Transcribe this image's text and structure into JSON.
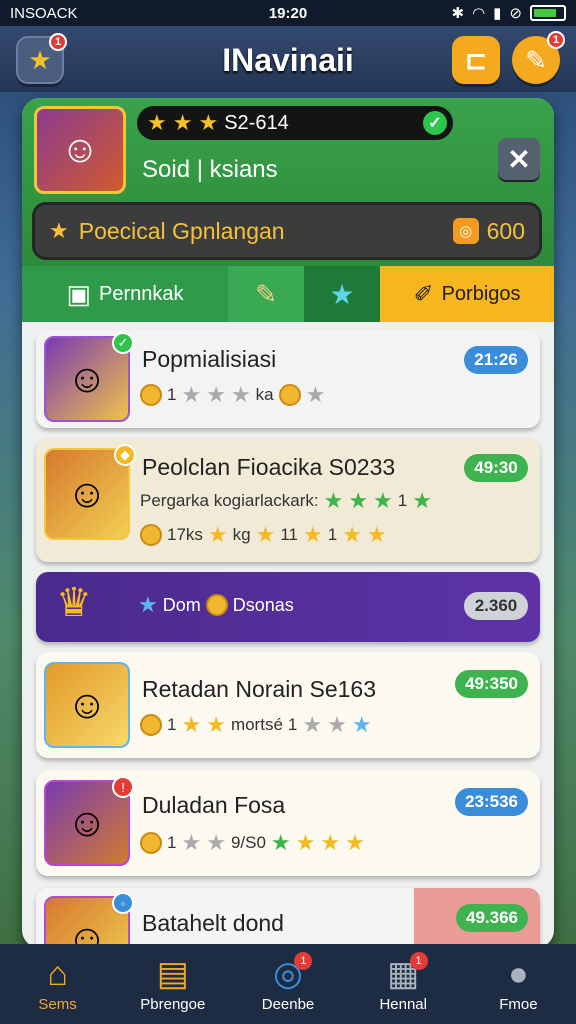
{
  "status": {
    "left": "INSOACK",
    "time": "19:20"
  },
  "header": {
    "title": "INavinaii",
    "left_badge": "1",
    "right_badge": "1"
  },
  "profile": {
    "stars_text": "S2-614",
    "name": "Soid | ksians",
    "special_label": "Poecical Gpnlangan",
    "special_value": "600"
  },
  "tabs": [
    {
      "label": "Pernnkak",
      "color": "#2f9a49"
    },
    {
      "label": "",
      "color": "#3aa954"
    },
    {
      "label": "",
      "color": "#1f7a3a"
    },
    {
      "label": "Porbigos",
      "color": "#f7b51e"
    }
  ],
  "cards": [
    {
      "name": "Popmialisiasi",
      "line1": "1",
      "line1b": "ka",
      "pill": "21:26",
      "pill_color": "#3a8dd8"
    },
    {
      "name": "Peolclan Fioacika S0233",
      "sub": "Pergarka kogiarlackark:",
      "sub_b": "1",
      "line1": "17ks",
      "line1b": "kg",
      "line1c": "11",
      "line1d": "1",
      "pill": "49:30",
      "pill_color": "#3fb34f"
    },
    {
      "name": "Dom",
      "name_b": "Dsonas",
      "pill": "2.360",
      "pill_color": "#cfd3d8"
    },
    {
      "name": "Retadan Norain Se163",
      "line1": "1",
      "line1b": "mortsé",
      "line1c": "1",
      "pill": "49:350",
      "pill_color": "#3fb34f"
    },
    {
      "name": "Duladan Fosa",
      "line1": "1",
      "line1b": "9/S0",
      "pill": "23:536",
      "pill_color": "#3a8dd8"
    },
    {
      "name": "Batahelt dond",
      "pill": "49.366",
      "pill_color": "#3fb34f"
    }
  ],
  "nav": [
    {
      "label": "Sems",
      "icon": "home-icon",
      "badge": ""
    },
    {
      "label": "Pbrengoe",
      "icon": "cards-icon",
      "badge": ""
    },
    {
      "label": "Deenbe",
      "icon": "target-icon",
      "badge": "1"
    },
    {
      "label": "Hennal",
      "icon": "grid-icon",
      "badge": "1"
    },
    {
      "label": "Fmoe",
      "icon": "profile-icon",
      "badge": ""
    }
  ]
}
